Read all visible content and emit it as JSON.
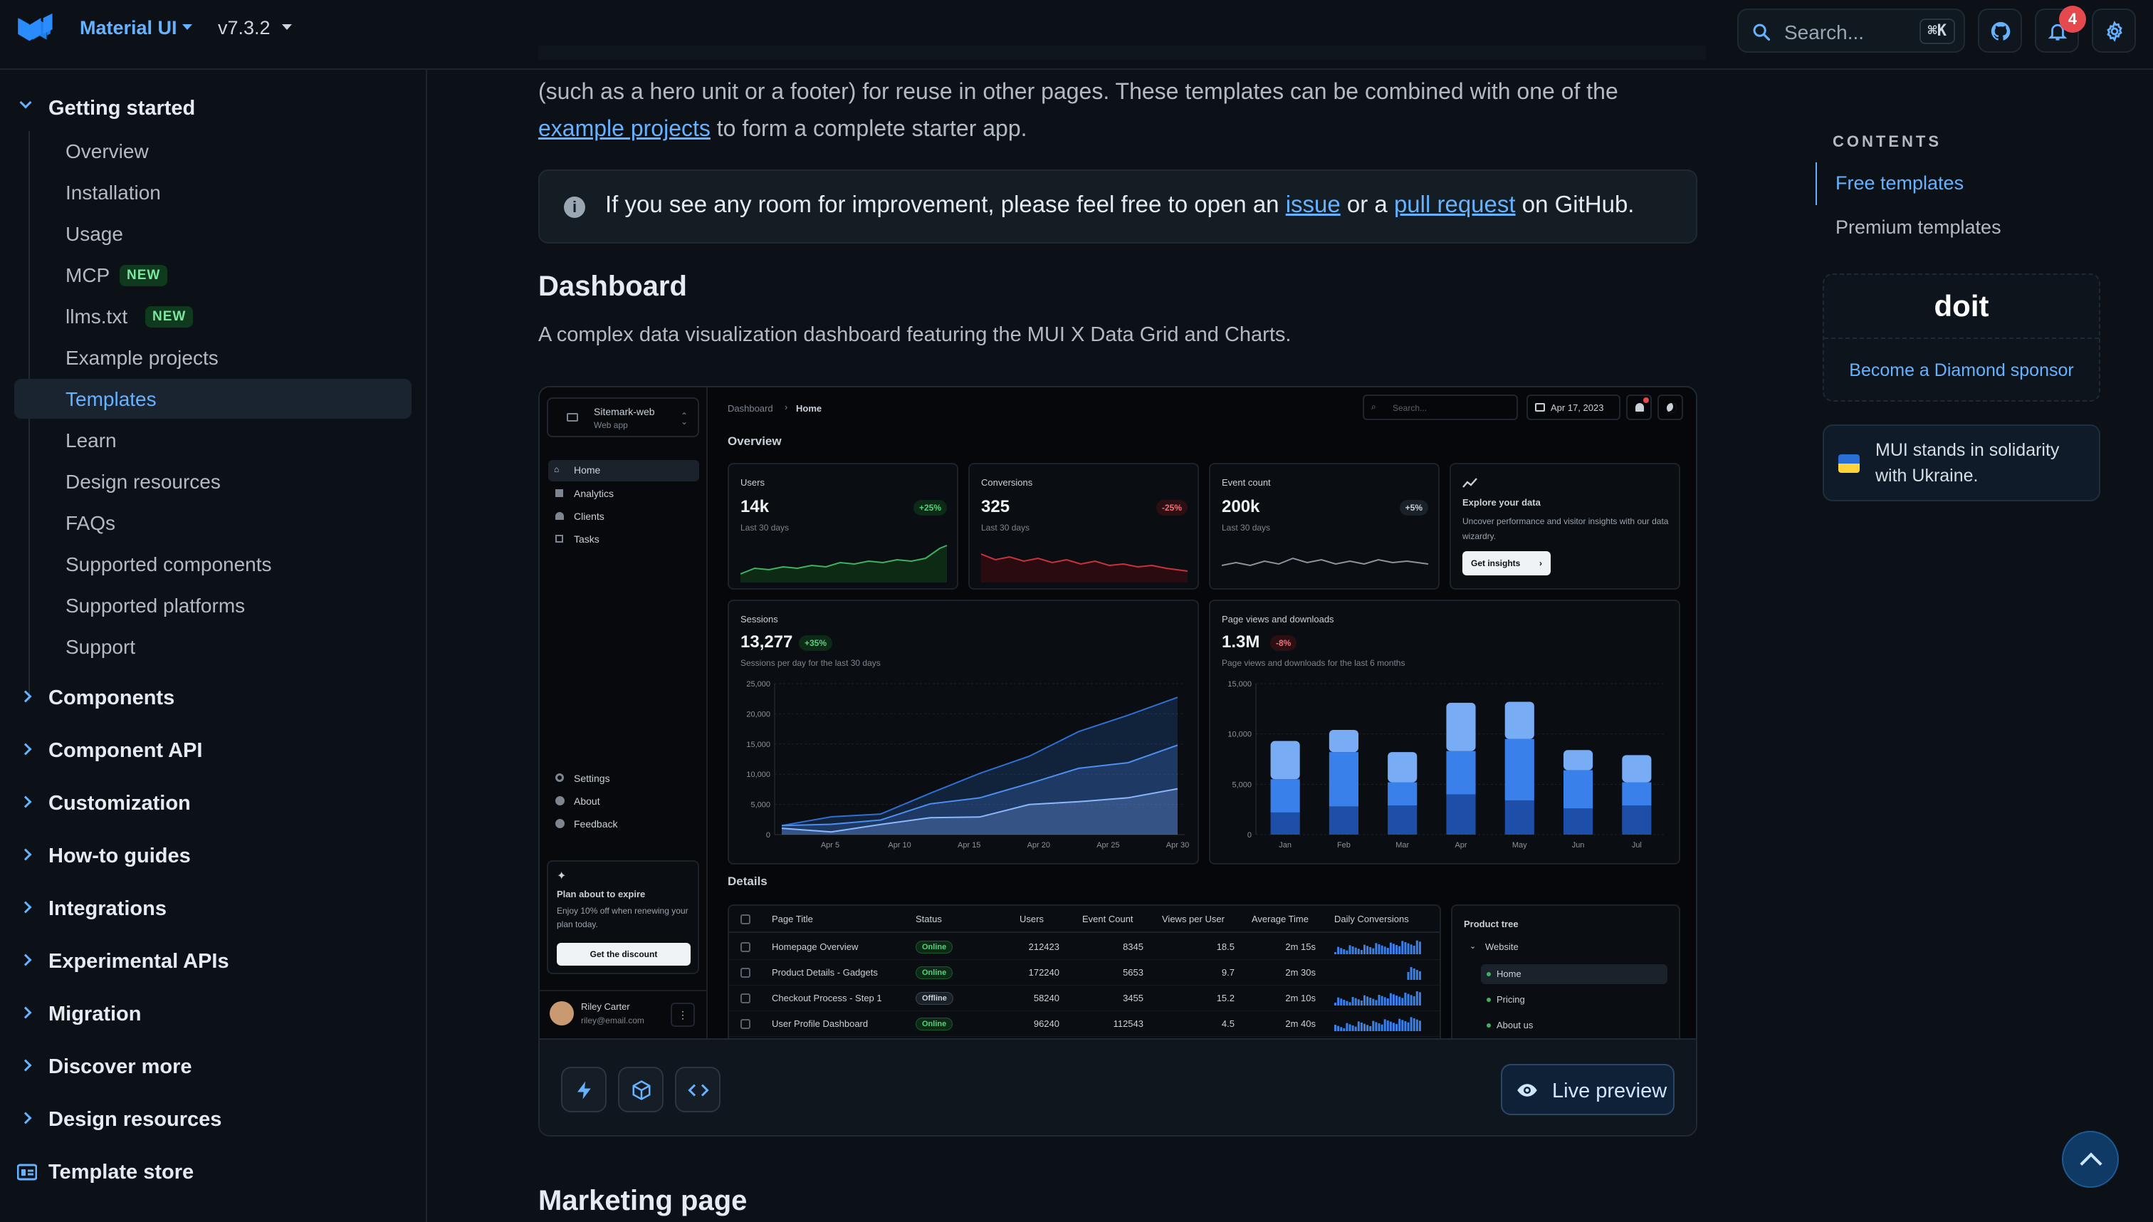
{
  "header": {
    "brand": "Material UI",
    "version": "v7.3.2",
    "search_placeholder": "Search...",
    "search_shortcut": "⌘K",
    "notifications_count": "4"
  },
  "sidebar": {
    "getting_started": "Getting started",
    "items": [
      {
        "label": "Overview"
      },
      {
        "label": "Installation"
      },
      {
        "label": "Usage"
      },
      {
        "label": "MCP",
        "badge": "NEW"
      },
      {
        "label": "llms.txt",
        "badge": "NEW"
      },
      {
        "label": "Example projects"
      },
      {
        "label": "Templates",
        "active": true
      },
      {
        "label": "Learn"
      },
      {
        "label": "Design resources"
      },
      {
        "label": "FAQs"
      },
      {
        "label": "Supported components"
      },
      {
        "label": "Supported platforms"
      },
      {
        "label": "Support"
      }
    ],
    "sections": [
      "Components",
      "Component API",
      "Customization",
      "How-to guides",
      "Integrations",
      "Experimental APIs",
      "Migration",
      "Discover more",
      "Design resources"
    ],
    "template_store": "Template store"
  },
  "main": {
    "intro_line1": "(such as a hero unit or a footer) for reuse in other pages. These templates can be combined with one of the",
    "intro_link": "example projects",
    "intro_rest": " to form a complete starter app.",
    "callout": {
      "pre": "If you see any room for improvement, please feel free to open an ",
      "link1": "issue",
      "mid": " or a ",
      "link2": "pull request",
      "post": " on GitHub."
    },
    "dashboard_title": "Dashboard",
    "dashboard_desc": "A complex data visualization dashboard featuring the MUI X Data Grid and Charts.",
    "live_preview": "Live preview",
    "next_title": "Marketing page"
  },
  "demo": {
    "team": "Sitemark-web",
    "team_sub": "Web app",
    "nav": [
      "Home",
      "Analytics",
      "Clients",
      "Tasks"
    ],
    "nav_bottom": [
      "Settings",
      "About",
      "Feedback"
    ],
    "plan_title": "Plan about to expire",
    "plan_desc": "Enjoy 10% off when renewing your plan today.",
    "plan_button": "Get the discount",
    "user_name": "Riley Carter",
    "user_email": "riley@email.com",
    "crumb1": "Dashboard",
    "crumb2": "Home",
    "search": "Search...",
    "date": "Apr 17, 2023",
    "overview": "Overview",
    "stats": [
      {
        "title": "Users",
        "value": "14k",
        "trend": "+25%",
        "tone": "up",
        "sub": "Last 30 days"
      },
      {
        "title": "Conversions",
        "value": "325",
        "trend": "-25%",
        "tone": "down",
        "sub": "Last 30 days"
      },
      {
        "title": "Event count",
        "value": "200k",
        "trend": "+5%",
        "tone": "neutral",
        "sub": "Last 30 days"
      }
    ],
    "explore_title": "Explore your data",
    "explore_desc": "Uncover performance and visitor insights with our data wizardry.",
    "explore_button": "Get insights",
    "sessions_title": "Sessions",
    "sessions_value": "13,277",
    "sessions_trend": "+35%",
    "sessions_sub": "Sessions per day for the last 30 days",
    "pv_title": "Page views and downloads",
    "pv_value": "1.3M",
    "pv_trend": "-8%",
    "pv_sub": "Page views and downloads for the last 6 months",
    "details": "Details",
    "table_headers": [
      "Page Title",
      "Status",
      "Users",
      "Event Count",
      "Views per User",
      "Average Time",
      "Daily Conversions"
    ],
    "rows": [
      {
        "title": "Homepage Overview",
        "status": "Online",
        "users": "212423",
        "events": "8345",
        "vpu": "18.5",
        "avg": "2m 15s"
      },
      {
        "title": "Product Details - Gadgets",
        "status": "Online",
        "users": "172240",
        "events": "5653",
        "vpu": "9.7",
        "avg": "2m 30s"
      },
      {
        "title": "Checkout Process - Step 1",
        "status": "Offline",
        "users": "58240",
        "events": "3455",
        "vpu": "15.2",
        "avg": "2m 10s"
      },
      {
        "title": "User Profile Dashboard",
        "status": "Online",
        "users": "96240",
        "events": "112543",
        "vpu": "4.5",
        "avg": "2m 40s"
      }
    ],
    "tree_title": "Product tree",
    "tree": [
      "Website",
      "Home",
      "Pricing",
      "About us"
    ]
  },
  "chart_data": [
    {
      "type": "area",
      "x": [
        "Apr 5",
        "Apr 10",
        "Apr 15",
        "Apr 20",
        "Apr 25",
        "Apr 30"
      ],
      "ylim": [
        0,
        25000
      ],
      "yticks": [
        "25,000",
        "20,000",
        "15,000",
        "10,000",
        "5,000",
        "0"
      ],
      "series": [
        {
          "values": [
            1500,
            2500,
            4000,
            6500,
            10000,
            13500,
            16500,
            20000,
            23000
          ]
        },
        {
          "values": [
            1000,
            1800,
            2800,
            4500,
            6500,
            8500,
            10500,
            12500,
            14500
          ]
        },
        {
          "values": [
            500,
            1000,
            1500,
            2500,
            3500,
            4500,
            5500,
            6500,
            7000
          ]
        }
      ],
      "colors": [
        "#2f6fd1",
        "#4d8ef0",
        "#8ab8ff"
      ],
      "grid": true
    },
    {
      "type": "bar",
      "categories": [
        "Jan",
        "Feb",
        "Mar",
        "Apr",
        "May",
        "Jun",
        "Jul"
      ],
      "ylim": [
        0,
        15000
      ],
      "yticks": [
        "15,000",
        "10,000",
        "5,000",
        "0"
      ],
      "series": [
        {
          "values": [
            2200,
            2800,
            2900,
            4000,
            3400,
            2600,
            2900
          ]
        },
        {
          "values": [
            3300,
            5400,
            2300,
            4300,
            6100,
            3800,
            2300
          ]
        },
        {
          "values": [
            3800,
            2200,
            3000,
            4800,
            3700,
            2000,
            2700
          ]
        }
      ],
      "colors": [
        "#1e4fa8",
        "#3a80eb",
        "#78acf5"
      ],
      "grid": true
    }
  ],
  "toc": {
    "title": "CONTENTS",
    "items": [
      "Free templates",
      "Premium templates"
    ]
  },
  "sponsor": {
    "logo": "doit",
    "cta": "Become a Diamond sponsor"
  },
  "ukraine": "MUI stands in solidarity with Ukraine."
}
